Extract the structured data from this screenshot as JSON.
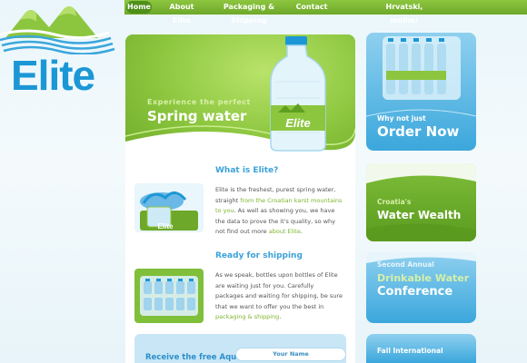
{
  "brand": {
    "name": "Elite"
  },
  "nav": {
    "items": [
      {
        "label": "Home",
        "active": true
      },
      {
        "label": "About Elite"
      },
      {
        "label": "Packaging & Shipping"
      },
      {
        "label": "Contact"
      }
    ],
    "language": "Hrvatski, molim!"
  },
  "hero": {
    "subtitle": "Experience the perfect",
    "title": "Spring water",
    "bottle_label": "Elite"
  },
  "sections": [
    {
      "heading": "What is Elite?",
      "text_1": "Elite is the freshest, purest spring water, straight ",
      "link_1": "from the Croatian karst mountains to you",
      "text_2": ". As well as showing you, we have the data to prove the it's quality, so why not find out more ",
      "link_2": "about Elite",
      "text_3": "."
    },
    {
      "heading": "Ready for shipping",
      "text_1": "As we speak, bottles upon bottles of Elite are waiting just for you. Carefully packages and waiting for shipping, be sure that we want to offer you the best in ",
      "link_1": "packaging & shipping",
      "text_2": "."
    }
  ],
  "signup": {
    "text": "Receive the free Aqua",
    "input_placeholder": "Your Name"
  },
  "side_cards": [
    {
      "subtitle": "Why not just",
      "title": "Order Now"
    },
    {
      "subtitle": "Croatia's",
      "title": "Water Wealth"
    },
    {
      "subtitle": "Second Annual",
      "title_1": "Drinkable Water",
      "title_2": "Conference"
    },
    {
      "subtitle": "Fall International"
    }
  ],
  "colors": {
    "accent_green": "#8cc63f",
    "accent_blue": "#3ba2d8",
    "logo_blue": "#1c97d6"
  }
}
